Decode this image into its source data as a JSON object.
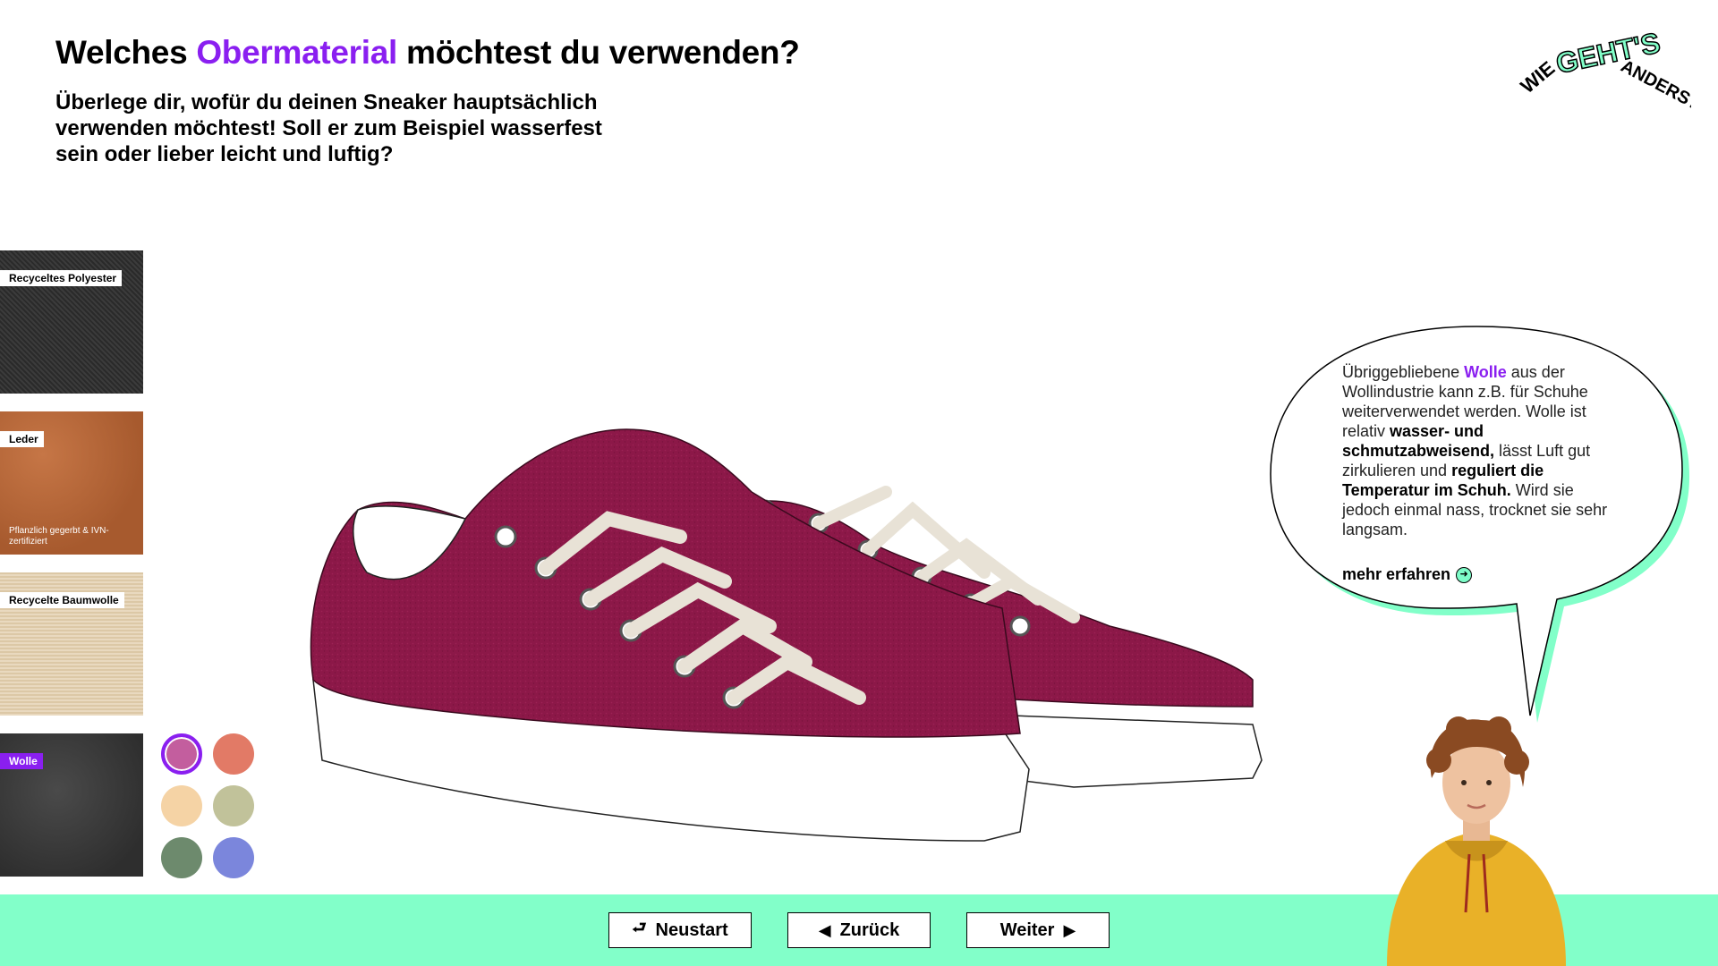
{
  "header": {
    "title_before": "Welches ",
    "title_accent": "Obermaterial",
    "title_after": " möchtest du verwenden?",
    "subtitle": "Überlege dir, wofür du deinen Sneaker hauptsächlich verwenden möchtest! Soll er zum Beispiel wasserfest sein oder lieber leicht und luftig?"
  },
  "logo": {
    "word1": "WIE",
    "word2": "GEHT'S",
    "word3": "ANDERS?"
  },
  "materials": [
    {
      "label": "Recyceltes Polyester",
      "note": "",
      "active": false
    },
    {
      "label": "Leder",
      "note": "Pflanzlich gegerbt & IVN-zertifiziert",
      "active": false
    },
    {
      "label": "Recycelte Baumwolle",
      "note": "",
      "active": false
    },
    {
      "label": "Wolle",
      "note": "",
      "active": true
    }
  ],
  "colors": [
    {
      "name": "mauve",
      "hex": "#c35e9e",
      "selected": true
    },
    {
      "name": "coral",
      "hex": "#e27a66",
      "selected": false
    },
    {
      "name": "peach",
      "hex": "#f5d3a5",
      "selected": false
    },
    {
      "name": "sage",
      "hex": "#c1c29a",
      "selected": false
    },
    {
      "name": "green",
      "hex": "#6d8a6d",
      "selected": false
    },
    {
      "name": "periwinkle",
      "hex": "#7b86dc",
      "selected": false
    }
  ],
  "info": {
    "t1": "Übriggebliebene ",
    "t2": "Wolle",
    "t3": " aus der Wollindustrie kann z.B. für Schuhe weiterverwendet werden. Wolle ist relativ ",
    "t4": "wasser- und schmutzabweisend,",
    "t5": " lässt Luft gut zirkulieren und ",
    "t6": "reguliert die Temperatur im Schuh.",
    "t7": " Wird sie jedoch einmal nass, trocknet sie sehr langsam.",
    "more_link": "mehr erfahren"
  },
  "nav": {
    "restart": "Neustart",
    "back": "Zurück",
    "next": "Weiter"
  },
  "theme": {
    "accent": "#8a1ff0",
    "mint": "#82ffc9",
    "shoe_color": "#8c1848"
  }
}
